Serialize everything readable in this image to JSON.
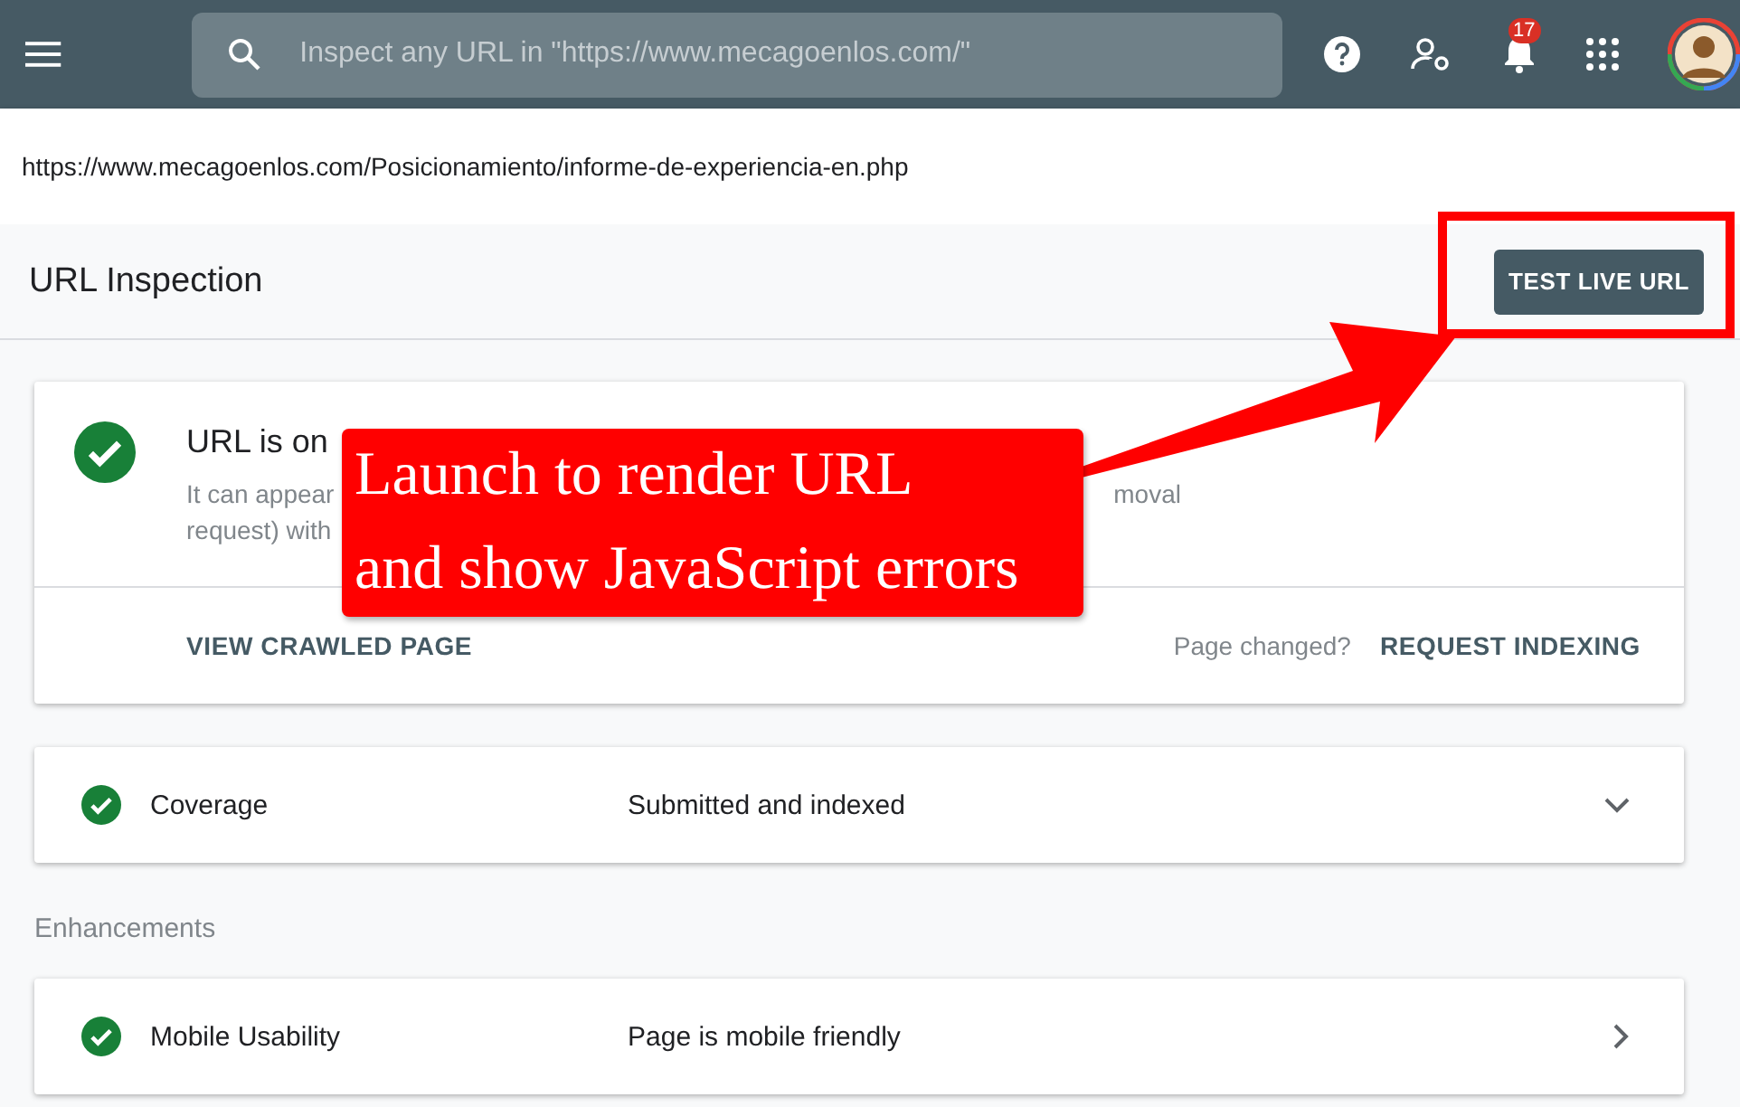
{
  "topbar": {
    "search": {
      "placeholder": "Inspect any URL in \"https://www.mecagoenlos.com/\""
    },
    "notifications": {
      "count": "17"
    }
  },
  "url": "https://www.mecagoenlos.com/Posicionamiento/informe-de-experiencia-en.php",
  "header": {
    "title": "URL Inspection",
    "button": "TEST LIVE URL"
  },
  "summary": {
    "title": "URL is on",
    "description_fragments": [
      [
        "It can appear",
        "moval"
      ],
      [
        "request) with"
      ]
    ],
    "actions": {
      "left": "VIEW CRAWLED PAGE",
      "note": "Page changed?",
      "right": "REQUEST INDEXING"
    }
  },
  "rows": [
    {
      "label": "Coverage",
      "status": "Submitted and indexed",
      "kind": "expand"
    }
  ],
  "enhancements": {
    "heading": "Enhancements",
    "rows": [
      {
        "label": "Mobile Usability",
        "status": "Page is mobile friendly",
        "kind": "link"
      }
    ]
  },
  "callout": {
    "lines": [
      "Launch to render URL",
      "and show JavaScript errors"
    ]
  }
}
